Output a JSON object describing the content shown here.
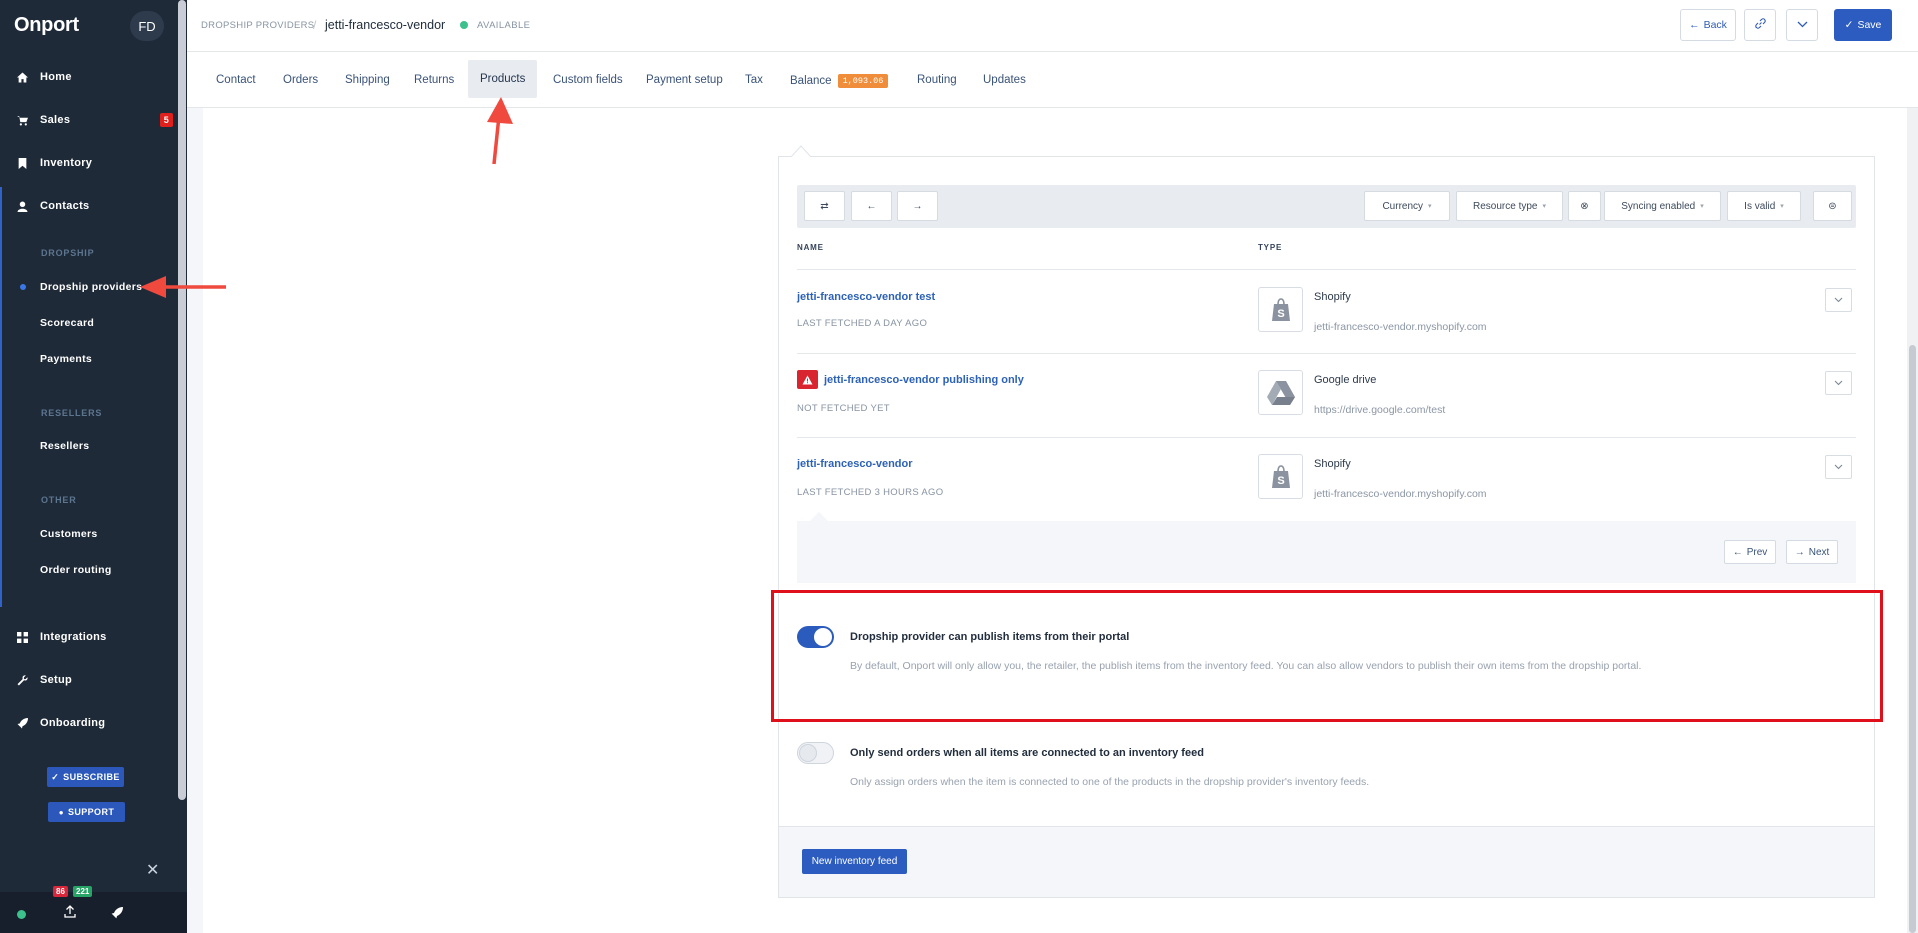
{
  "sidebar": {
    "logo": "Onport",
    "avatar": "FD",
    "nav": [
      {
        "label": "Home",
        "icon": "home-icon"
      },
      {
        "label": "Sales",
        "icon": "cart-icon",
        "badge": "5"
      },
      {
        "label": "Inventory",
        "icon": "bookmark-icon"
      },
      {
        "label": "Contacts",
        "icon": "user-icon"
      }
    ],
    "dropship_section": "DROPSHIP",
    "dropship_items": [
      "Dropship providers",
      "Scorecard",
      "Payments"
    ],
    "resellers_section": "RESELLERS",
    "resellers_items": [
      "Resellers"
    ],
    "other_section": "OTHER",
    "other_items": [
      "Customers",
      "Order routing"
    ],
    "nav2": [
      {
        "label": "Integrations",
        "icon": "grid-icon"
      },
      {
        "label": "Setup",
        "icon": "wrench-icon"
      },
      {
        "label": "Onboarding",
        "icon": "rocket-icon"
      }
    ],
    "subscribe": "SUBSCRIBE",
    "support": "SUPPORT",
    "count_red": "86",
    "count_green": "221"
  },
  "header": {
    "breadcrumb": "DROPSHIP PROVIDERS",
    "title": "jetti-francesco-vendor",
    "status": "AVAILABLE",
    "back": "Back",
    "save": "Save"
  },
  "tabs": [
    "Contact",
    "Orders",
    "Shipping",
    "Returns",
    "Products",
    "Custom fields",
    "Payment setup",
    "Tax",
    "Balance",
    "Routing",
    "Updates"
  ],
  "active_tab": "Products",
  "balance_badge": "1,093.06",
  "filters": [
    "Currency",
    "Resource type",
    "Syncing enabled",
    "Is valid"
  ],
  "columns": {
    "name": "NAME",
    "type": "TYPE"
  },
  "feeds": [
    {
      "name": "jetti-francesco-vendor test",
      "status": "LAST FETCHED A DAY AGO",
      "type": "Shopify",
      "url": "jetti-francesco-vendor.myshopify.com"
    },
    {
      "name": "jetti-francesco-vendor publishing only",
      "status": "NOT FETCHED YET",
      "type": "Google drive",
      "url": "https://drive.google.com/test"
    },
    {
      "name": "jetti-francesco-vendor",
      "status": "LAST FETCHED 3 HOURS AGO",
      "type": "Shopify",
      "url": "jetti-francesco-vendor.myshopify.com"
    }
  ],
  "pager": {
    "prev": "Prev",
    "next": "Next"
  },
  "settings": [
    {
      "title": "Dropship provider can publish items from their portal",
      "desc": "By default, Onport will only allow you, the retailer, the publish items from the inventory feed. You can also allow vendors to publish their own items from the dropship portal.",
      "enabled": true
    },
    {
      "title": "Only send orders when all items are connected to an inventory feed",
      "desc": "Only assign orders when the item is connected to one of the products in the dropship provider's inventory feeds.",
      "enabled": false
    }
  ],
  "new_feed": "New inventory feed",
  "colors": {
    "primary": "#2d5cc0",
    "sidebar": "#1f2a38",
    "annotation": "#e0101a",
    "balance": "#f08d3a"
  }
}
